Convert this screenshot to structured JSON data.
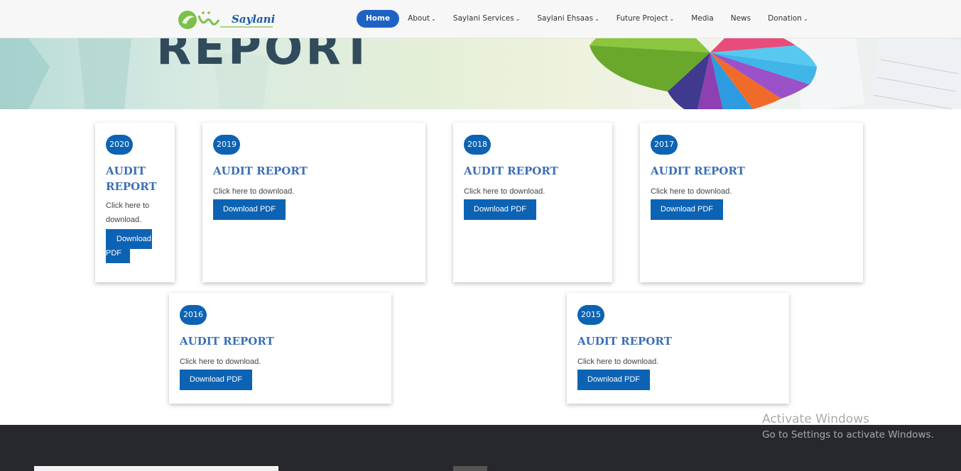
{
  "header": {
    "logo_text": "Saylani",
    "nav": [
      {
        "label": "Home",
        "caret": false,
        "active": true
      },
      {
        "label": "About",
        "caret": true,
        "active": false
      },
      {
        "label": "Saylani Services",
        "caret": true,
        "active": false
      },
      {
        "label": "Saylani Ehsaas",
        "caret": true,
        "active": false
      },
      {
        "label": "Future Project",
        "caret": true,
        "active": false
      },
      {
        "label": "Media",
        "caret": false,
        "active": false
      },
      {
        "label": "News",
        "caret": false,
        "active": false
      },
      {
        "label": "Donation",
        "caret": true,
        "active": false
      }
    ]
  },
  "banner": {
    "heading": "REPORT"
  },
  "cards": [
    {
      "year": "2020",
      "title": "AUDIT REPORT",
      "desc": "Click here to download.",
      "button": "Download PDF"
    },
    {
      "year": "2019",
      "title": "AUDIT REPORT",
      "desc": "Click here to download.",
      "button": "Download PDF"
    },
    {
      "year": "2018",
      "title": "AUDIT REPORT",
      "desc": "Click here to download.",
      "button": "Download PDF"
    },
    {
      "year": "2017",
      "title": "AUDIT REPORT",
      "desc": "Click here to download.",
      "button": "Download PDF"
    },
    {
      "year": "2016",
      "title": "AUDIT REPORT",
      "desc": "Click here to download.",
      "button": "Download PDF"
    },
    {
      "year": "2015",
      "title": "AUDIT REPORT",
      "desc": "Click here to download.",
      "button": "Download PDF"
    }
  ],
  "narrow_card": {
    "title_line1": "AUDIT",
    "title_line2": "REPORT",
    "desc_line1": "Click here to",
    "desc_line2": "download.",
    "btn_line1": "Download",
    "btn_line2": "PDF"
  },
  "watermark": {
    "line1": "Activate Windows",
    "line2": "Go to Settings to activate Windows."
  },
  "colors": {
    "primary": "#0d63b3",
    "title": "#3c6fb7",
    "footer": "#26282e"
  }
}
